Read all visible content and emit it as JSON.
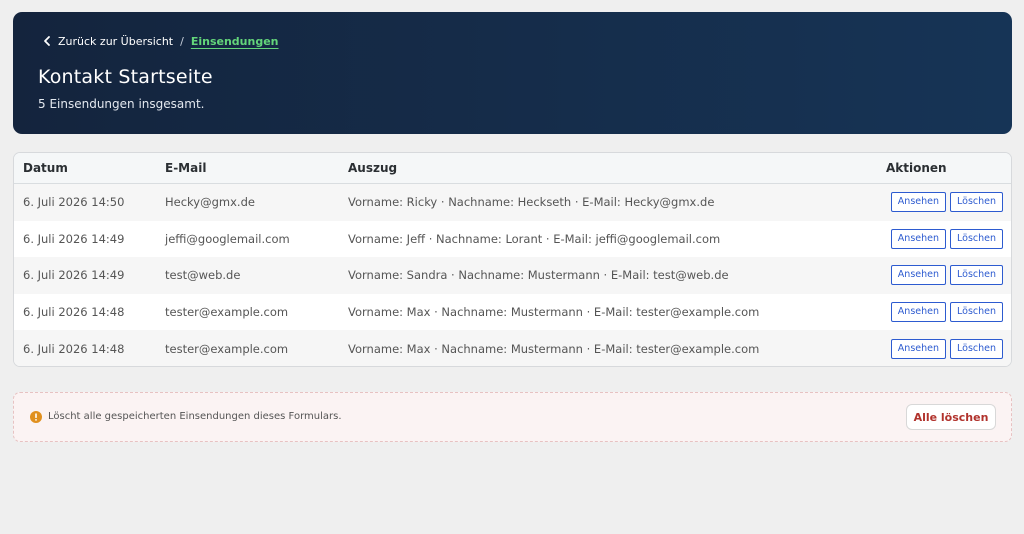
{
  "breadcrumb": {
    "back_label": "Zurück zur Übersicht",
    "separator": "/",
    "current": "Einsendungen"
  },
  "page": {
    "title": "Kontakt Startseite",
    "subtitle": "5 Einsendungen insgesamt."
  },
  "table": {
    "columns": [
      "Datum",
      "E-Mail",
      "Auszug",
      "Aktionen"
    ],
    "rows": [
      {
        "date": "6. Juli 2026 14:50",
        "email": "Hecky@gmx.de",
        "excerpt": "Vorname: Ricky · Nachname: Heckseth · E-Mail: Hecky@gmx.de"
      },
      {
        "date": "6. Juli 2026 14:49",
        "email": "jeffi@googlemail.com",
        "excerpt": "Vorname: Jeff · Nachname: Lorant · E-Mail: jeffi@googlemail.com"
      },
      {
        "date": "6. Juli 2026 14:49",
        "email": "test@web.de",
        "excerpt": "Vorname: Sandra · Nachname: Mustermann · E-Mail: test@web.de"
      },
      {
        "date": "6. Juli 2026 14:48",
        "email": "tester@example.com",
        "excerpt": "Vorname: Max · Nachname: Mustermann · E-Mail: tester@example.com"
      },
      {
        "date": "6. Juli 2026 14:48",
        "email": "tester@example.com",
        "excerpt": "Vorname: Max · Nachname: Mustermann · E-Mail: tester@example.com"
      }
    ],
    "actions": {
      "view_label": "Ansehen",
      "delete_label": "Löschen"
    }
  },
  "danger": {
    "text": "Löscht alle gespeicherten Einsendungen dieses Formulars.",
    "button_label": "Alle löschen",
    "icon": "warning-icon"
  },
  "colors": {
    "header_bg": "#14243d",
    "accent_green": "#63d57a",
    "action_blue": "#2d5bd0",
    "danger_red": "#b1322c",
    "warning_orange": "#e0901f"
  }
}
